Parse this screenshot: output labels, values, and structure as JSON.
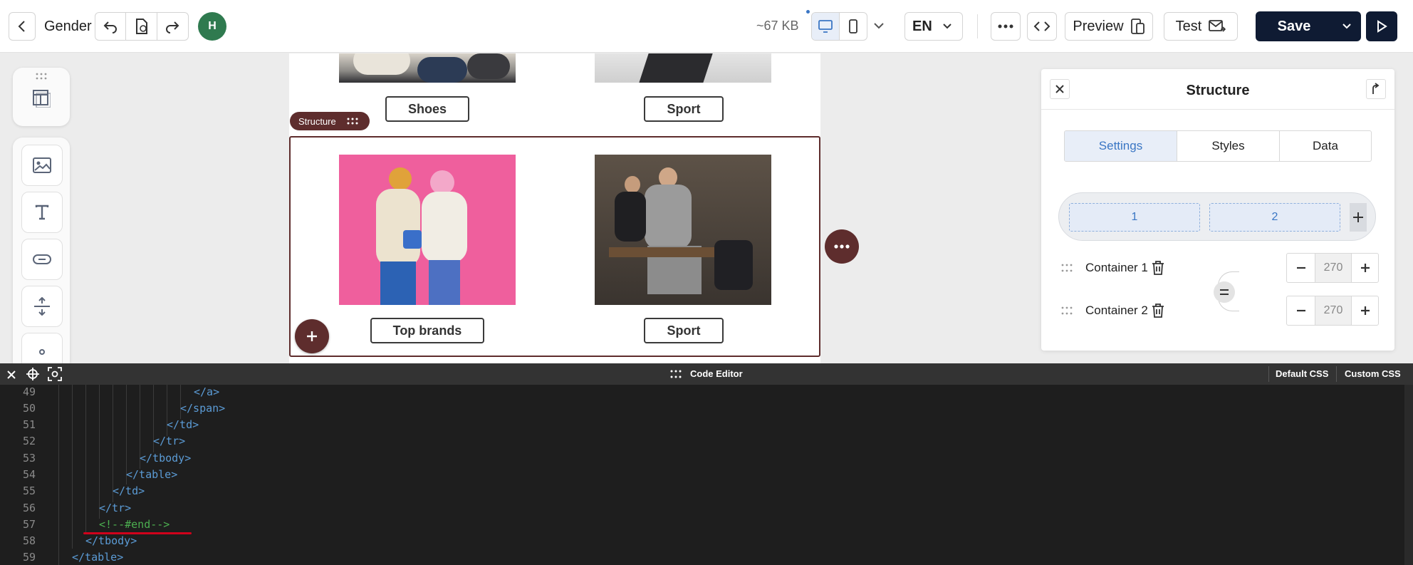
{
  "header": {
    "title": "Gender",
    "avatar_initial": "H",
    "file_size": "~67 KB",
    "language": "EN",
    "preview_label": "Preview",
    "test_label": "Test",
    "save_label": "Save"
  },
  "email": {
    "top_row": {
      "left_button": "Shoes",
      "right_button": "Sport"
    },
    "structure_tag": "Structure",
    "bottom_row": {
      "left_button": "Top brands",
      "right_button": "Sport"
    }
  },
  "panel": {
    "title": "Structure",
    "tabs": [
      "Settings",
      "Styles",
      "Data"
    ],
    "columns": [
      "1",
      "2"
    ],
    "containers": [
      {
        "label": "Container 1",
        "value": "270"
      },
      {
        "label": "Container 2",
        "value": "270"
      }
    ]
  },
  "code_editor": {
    "title": "Code Editor",
    "default_css": "Default CSS",
    "custom_css": "Custom CSS",
    "lines": [
      {
        "num": "49",
        "text": "</a>"
      },
      {
        "num": "50",
        "text": "</span>"
      },
      {
        "num": "51",
        "text": "</td>"
      },
      {
        "num": "52",
        "text": "</tr>"
      },
      {
        "num": "53",
        "text": "</tbody>"
      },
      {
        "num": "54",
        "text": "</table>"
      },
      {
        "num": "55",
        "text": "</td>"
      },
      {
        "num": "56",
        "text": "</tr>"
      },
      {
        "num": "57",
        "text": "<!--#end-->"
      },
      {
        "num": "58",
        "text": "</tbody>"
      },
      {
        "num": "59",
        "text": "</table>"
      }
    ]
  },
  "colors": {
    "brand_dark": "#0f1b33",
    "structure_maroon": "#5e2d2d",
    "accent_blue": "#3a76c4",
    "comment_green": "#4caf50",
    "underline_red": "#d0021b"
  }
}
